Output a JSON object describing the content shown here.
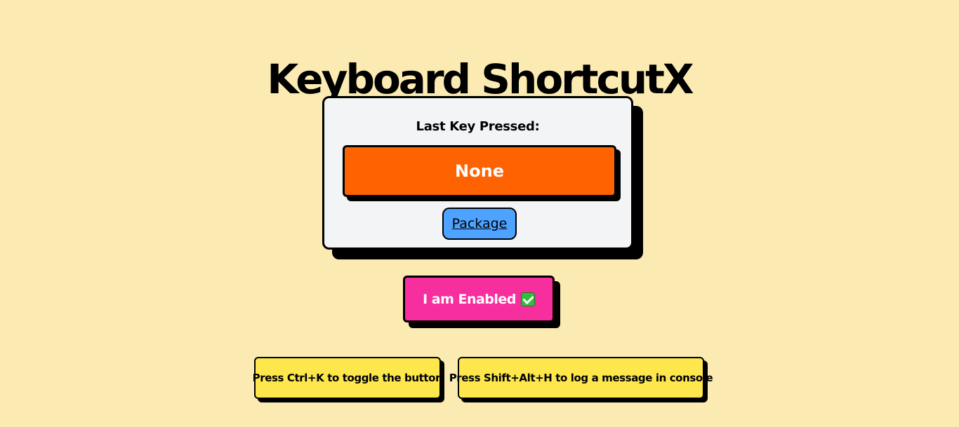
{
  "page": {
    "title": "Keyboard ShortcutX"
  },
  "card": {
    "label": "Last Key Pressed:",
    "last_key": "None",
    "package_link": "Package"
  },
  "toggle_button": {
    "label": "I am Enabled",
    "icon": "check-mark-icon"
  },
  "hints": [
    "Press Ctrl+K to toggle the button",
    "Press Shift+Alt+H to log a message in console"
  ],
  "colors": {
    "background": "#fbebb2",
    "card": "#f3f4f6",
    "key_display": "#ff6200",
    "package_link": "#4da3ff",
    "toggle_button": "#f72e9e",
    "hint": "#fde74c",
    "check_icon": "#2fbf3a"
  }
}
